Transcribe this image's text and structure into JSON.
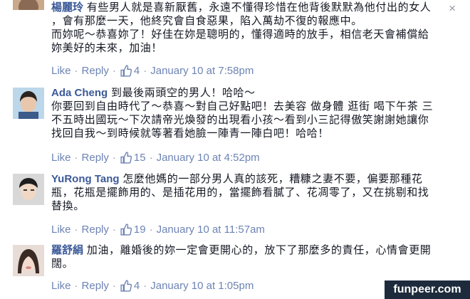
{
  "ui": {
    "like_label": "Like",
    "reply_label": "Reply",
    "separator": "·",
    "close_glyph": "×"
  },
  "comments": [
    {
      "author": "楊麗玲",
      "lines": [
        "有些男人就是喜新厭舊，永遠不懂得珍惜在他背後默默為他付出的女人",
        "，會有那麼一天，他終究會自食惡果，陷入萬劫不復的報應中。",
        "而妳呢～恭喜妳了！好佳在妳是聰明的，懂得適時的放手，相信老天會補償給",
        "妳美好的未來，加油！"
      ],
      "likes": "4",
      "timestamp": "January 10 at 7:58pm"
    },
    {
      "author": "Ada Cheng",
      "lines": [
        "到最後兩頭空的男人！哈哈～",
        "你要回到自由時代了～恭喜～對自己好點吧！去美容 做身體 逛街 喝下午茶 三",
        "不五時出國玩～下次請帝光煥發的出現看小孩～看到小三記得傲笑謝謝她讓你",
        "找回自我～到時候就等著看她臉一陣青一陣白吧！哈哈！"
      ],
      "likes": "15",
      "timestamp": "January 10 at 4:52pm"
    },
    {
      "author": "YuRong Tang",
      "lines": [
        "怎麼他媽的一部分男人真的該死，糟糠之妻不要，偏要那種花",
        "瓶，花瓶是擺飾用的、是插花用的，當擺飾看膩了、花凋零了，又在挑剔和找",
        "替換。"
      ],
      "likes": "19",
      "timestamp": "January 10 at 11:57am"
    },
    {
      "author": "羅舒絹",
      "lines": [
        "加油，離婚後的妳一定會更開心的，放下了那麼多的責任，心情會更開",
        "闊。"
      ],
      "likes": "4",
      "timestamp": "January 10 at 1:05pm"
    }
  ],
  "watermark": "funpeer.com",
  "colors": {
    "link": "#3b5998",
    "action": "#6d84b4",
    "meta": "#9197a3",
    "watermark_bg": "#1d2b3c"
  }
}
